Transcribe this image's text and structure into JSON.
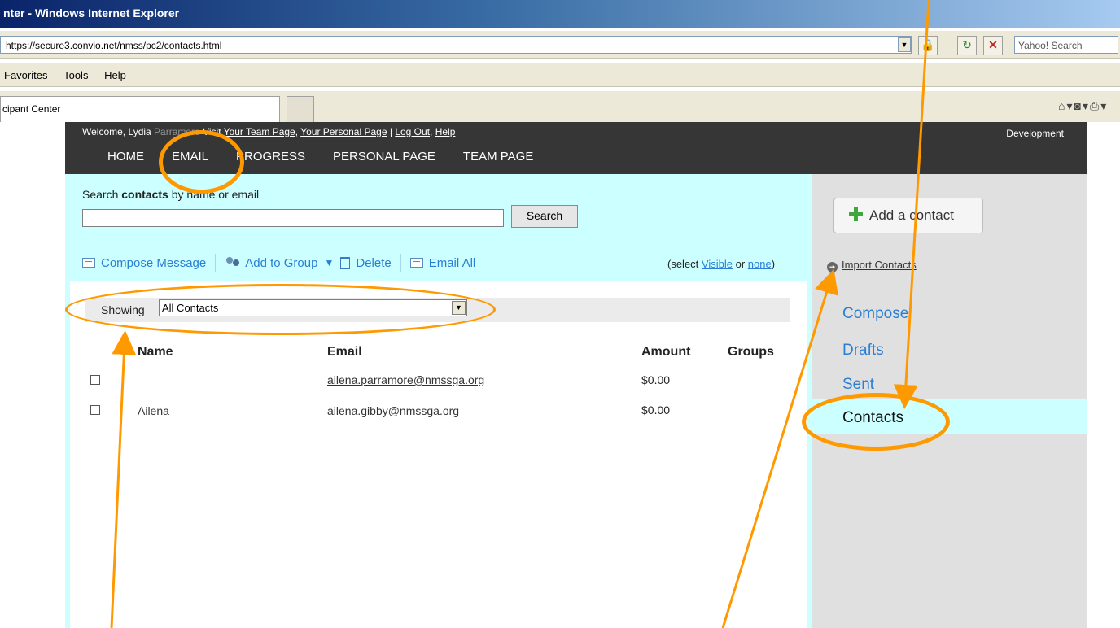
{
  "browser": {
    "title": "nter - Windows Internet Explorer",
    "url": "https://secure3.convio.net/nmss/pc2/contacts.html",
    "search_placeholder": "Yahoo! Search",
    "menu": [
      "Favorites",
      "Tools",
      "Help"
    ],
    "tab_title": "cipant Center"
  },
  "header": {
    "welcome_prefix": "Welcome, Lydia",
    "welcome_hidden": "Parramore",
    "visit_label": "Visit",
    "team_page_link": "Your Team Page",
    "comma": ",",
    "personal_page_link": "Your Personal Page",
    "sep1": "|",
    "logout_link": "Log Out",
    "help_link": "Help",
    "right_label": "Development",
    "nav": [
      "HOME",
      "EMAIL",
      "PROGRESS",
      "PERSONAL PAGE",
      "TEAM PAGE"
    ]
  },
  "search": {
    "label_prefix": "Search",
    "label_bold": "contacts",
    "label_suffix": "by name or email",
    "value": "",
    "button": "Search"
  },
  "actions": {
    "compose": "Compose Message",
    "add_to_group": "Add to Group",
    "delete": "Delete",
    "email_all": "Email All",
    "select_prefix": "(select",
    "visible": "Visible",
    "or": "or",
    "none": "none",
    "select_suffix": ")"
  },
  "filter": {
    "label": "Showing",
    "selected": "All Contacts"
  },
  "table": {
    "headers": [
      "Name",
      "Email",
      "Amount",
      "Groups"
    ],
    "rows": [
      {
        "name": "",
        "email": "ailena.parramore@nmssga.org",
        "amount": "$0.00",
        "groups": ""
      },
      {
        "name": "Ailena",
        "email": "ailena.gibby@nmssga.org",
        "amount": "$0.00",
        "groups": ""
      }
    ]
  },
  "sidebar": {
    "add_contact": "Add a contact",
    "import_contacts": "Import Contacts",
    "items": [
      "Compose",
      "Drafts",
      "Sent",
      "Contacts"
    ],
    "active_item": "Contacts"
  },
  "colors": {
    "annotation": "#ff9900",
    "header_bg": "#363636",
    "panel_bg": "#ccffff",
    "sidebar_bg": "#e0e0e0",
    "link_blue": "#2a7fd4"
  }
}
